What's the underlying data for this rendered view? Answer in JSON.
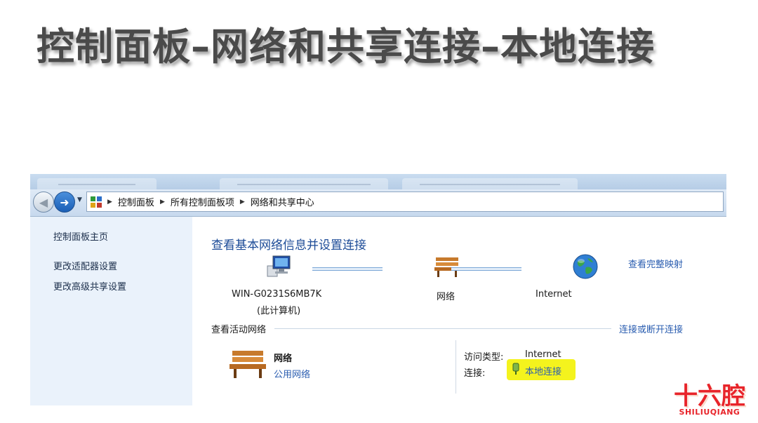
{
  "slide": {
    "title": "控制面板–网络和共享连接–本地连接"
  },
  "explorer": {
    "breadcrumb": [
      "控制面板",
      "所有控制面板项",
      "网络和共享中心"
    ]
  },
  "sidebar": {
    "items": [
      {
        "label": "控制面板主页"
      },
      {
        "label": "更改适配器设置"
      },
      {
        "label": "更改高级共享设置"
      }
    ]
  },
  "main": {
    "heading": "查看基本网络信息并设置连接",
    "map_link": "查看完整映射",
    "nodes": {
      "computer": {
        "name": "WIN-G0231S6MB7K",
        "sub": "(此计算机)",
        "icon": "computer-icon"
      },
      "network": {
        "name": "网络",
        "icon": "bench-icon"
      },
      "internet": {
        "name": "Internet",
        "icon": "globe-icon"
      }
    },
    "active_section": {
      "title": "查看活动网络",
      "link": "连接或断开连接"
    },
    "active_network": {
      "name": "网络",
      "type": "公用网络",
      "access_label": "访问类型:",
      "access_value": "Internet",
      "connection_label": "连接:",
      "connection_value": "本地连接",
      "highlight_color": "#f4f31d"
    }
  },
  "logo": {
    "main": "十六腔",
    "sub": "SHILIUQIANG",
    "color": "#e8242a"
  }
}
